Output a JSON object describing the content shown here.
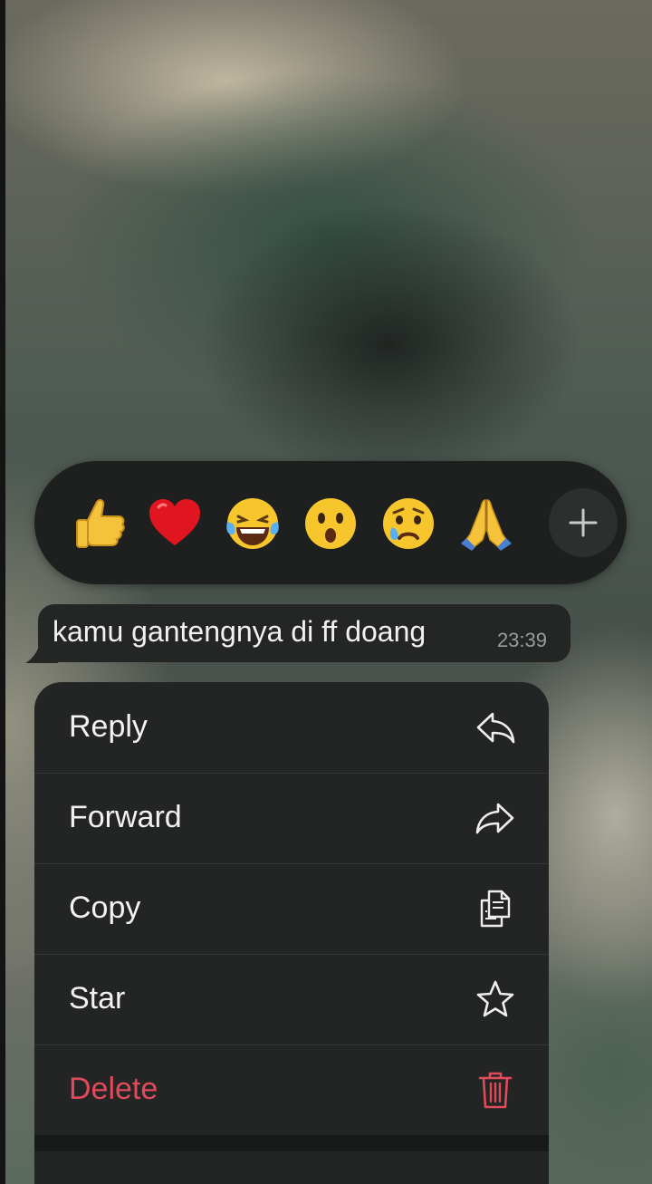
{
  "reactions": {
    "items": [
      {
        "name": "thumbs-up",
        "emoji": "👍"
      },
      {
        "name": "red-heart",
        "emoji": "❤️"
      },
      {
        "name": "tears-of-joy",
        "emoji": "😂"
      },
      {
        "name": "surprised",
        "emoji": "😮"
      },
      {
        "name": "sad-tear",
        "emoji": "😢"
      },
      {
        "name": "folded-hands",
        "emoji": "🙏"
      }
    ],
    "more_icon": "plus-icon"
  },
  "message": {
    "text": "kamu gantengnya di ff doang",
    "time": "23:39"
  },
  "menu": {
    "items": [
      {
        "label": "Reply",
        "icon": "reply-icon"
      },
      {
        "label": "Forward",
        "icon": "forward-icon"
      },
      {
        "label": "Copy",
        "icon": "copy-icon"
      },
      {
        "label": "Star",
        "icon": "star-icon"
      },
      {
        "label": "Delete",
        "icon": "trash-icon"
      }
    ],
    "danger_color": "#e04a5a"
  }
}
